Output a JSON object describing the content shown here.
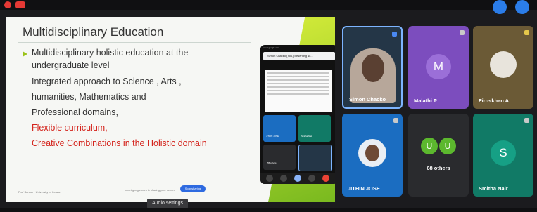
{
  "slide": {
    "title": "Multidisciplinary Education",
    "lines": [
      "Multidisciplinary holistic education at the",
      "undergraduate level",
      "Integrated approach to Science   , Arts ,",
      "humanities, Mathematics and",
      "Professional domains,",
      "Flexible curriculum,",
      "Creative Combinations in the Holistic domain"
    ],
    "footer_left": "Prof Suresh · University of Kerala",
    "footer_mid": "meet.google.com is sharing your screen",
    "share_button": "Stop sharing",
    "colors": {
      "accent_green": "#9bc31a",
      "red_text": "#d4231b",
      "share_button": "#2e6ae0"
    }
  },
  "phone": {
    "url": "meet.google.com",
    "sharing_text": "Simon Chacko (You, presenting sc...",
    "mini_tiles": [
      "JITHIN JOSE",
      "Smitha Nair",
      "55 others"
    ]
  },
  "participants": [
    {
      "name": "Simon Chacko",
      "avatar": "",
      "color": "#243647",
      "type": "video"
    },
    {
      "name": "Malathi P",
      "avatar": "M",
      "color": "#7c4dbe",
      "type": "avatar"
    },
    {
      "name": "Firoskhan A",
      "avatar": "",
      "color": "#6b5a36",
      "type": "photo"
    },
    {
      "name": "JITHIN JOSE",
      "avatar": "",
      "color": "#1b6dc1",
      "type": "photo"
    },
    {
      "name": "68 others",
      "avatar": [
        "U",
        "U"
      ],
      "color": "#2a2b2e",
      "type": "others"
    },
    {
      "name": "Smitha Nair",
      "avatar": "S",
      "color": "#117a66",
      "type": "avatar"
    }
  ],
  "tooltip": "Audio settings"
}
